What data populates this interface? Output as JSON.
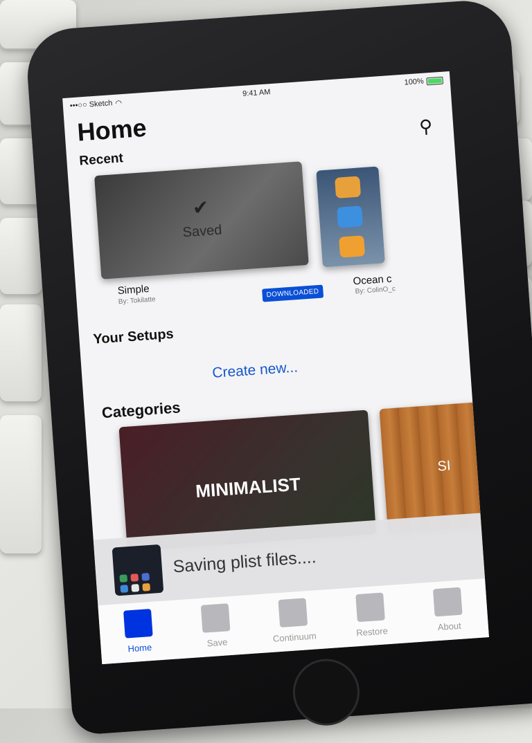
{
  "status_bar": {
    "carrier": "•••○○ Sketch",
    "time": "9:41 AM",
    "battery": "100%"
  },
  "header": {
    "title": "Home"
  },
  "recent": {
    "heading": "Recent",
    "items": [
      {
        "name": "Simple",
        "author": "By: Tokilatte",
        "overlay_label": "Saved",
        "badge": "DOWNLOADED"
      },
      {
        "name": "Ocean c",
        "author": "By: ColinO_c"
      }
    ]
  },
  "setups": {
    "heading": "Your Setups",
    "create_label": "Create new..."
  },
  "categories": {
    "heading": "Categories",
    "items": [
      {
        "label": "MINIMALIST"
      },
      {
        "label": "SI"
      }
    ]
  },
  "toast": {
    "message": "Saving plist files...."
  },
  "tabbar": {
    "tabs": [
      {
        "label": "Home",
        "active": true
      },
      {
        "label": "Save"
      },
      {
        "label": "Continuum"
      },
      {
        "label": "Restore"
      },
      {
        "label": "About"
      }
    ]
  },
  "colors": {
    "accent": "#0a4fd6",
    "active_tab": "#0033e0"
  }
}
